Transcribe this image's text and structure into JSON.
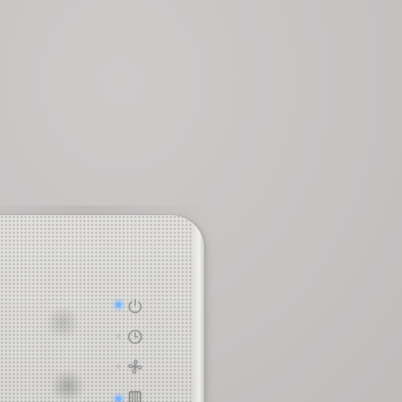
{
  "scene": {
    "wall_color": "#c8c6c5",
    "device_color": "#dedddb"
  },
  "controls": [
    {
      "name": "power-icon",
      "icon": "power",
      "led_on": true
    },
    {
      "name": "timer-icon",
      "icon": "timer",
      "led_on": false
    },
    {
      "name": "fan-icon",
      "icon": "fan",
      "led_on": false
    },
    {
      "name": "filter-icon",
      "icon": "filter",
      "led_on": true
    }
  ],
  "colors": {
    "led_blue": "#6fb4ff",
    "icon_stroke": "#8a8a8a"
  }
}
